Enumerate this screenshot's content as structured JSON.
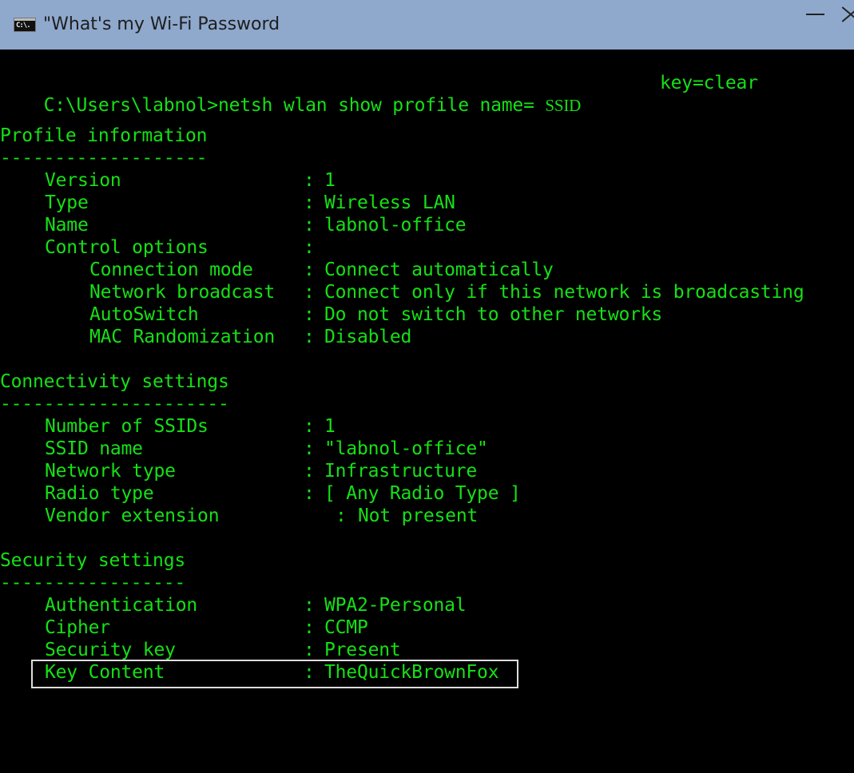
{
  "window": {
    "title": "\"What's my Wi-Fi Password",
    "icon_text": "C:\\.",
    "controls": [
      "minimize-icon",
      "close-icon"
    ]
  },
  "command": {
    "prompt": "C:\\Users\\labnol>",
    "text": "netsh wlan show profile name= ",
    "ssid_placeholder": "SSID",
    "arg_key": "key=clear"
  },
  "sections": {
    "profile": {
      "heading": "Profile information",
      "underline": "-------------------",
      "rows": [
        {
          "label": "Version",
          "value": "1"
        },
        {
          "label": "Type",
          "value": "Wireless LAN"
        },
        {
          "label": "Name",
          "value": "labnol-office"
        },
        {
          "label": "Control options",
          "value": ""
        }
      ],
      "control_rows": [
        {
          "label": "Connection mode",
          "value": "Connect automatically"
        },
        {
          "label": "Network broadcast",
          "value": "Connect only if this network is broadcasting"
        },
        {
          "label": "AutoSwitch",
          "value": "Do not switch to other networks"
        },
        {
          "label": "MAC Randomization",
          "value": "Disabled"
        }
      ]
    },
    "connectivity": {
      "heading": "Connectivity settings",
      "underline": "---------------------",
      "rows": [
        {
          "label": "Number of SSIDs",
          "value": "1"
        },
        {
          "label": "SSID name",
          "value": "\"labnol-office\""
        },
        {
          "label": "Network type",
          "value": "Infrastructure"
        },
        {
          "label": "Radio type",
          "value": "[ Any Radio Type ]"
        },
        {
          "label": "Vendor extension",
          "value": "Not present"
        }
      ]
    },
    "security": {
      "heading": "Security settings",
      "underline": "-----------------",
      "rows": [
        {
          "label": "Authentication",
          "value": "WPA2-Personal"
        },
        {
          "label": "Cipher",
          "value": "CCMP"
        },
        {
          "label": "Security key",
          "value": "Present"
        },
        {
          "label": "Key Content",
          "value": "TheQuickBrownFox"
        }
      ]
    }
  },
  "colors": {
    "console_text": "#16e016",
    "console_bg": "#000000",
    "titlebar": "#8fa9cd",
    "highlight_border": "#dddddd"
  }
}
